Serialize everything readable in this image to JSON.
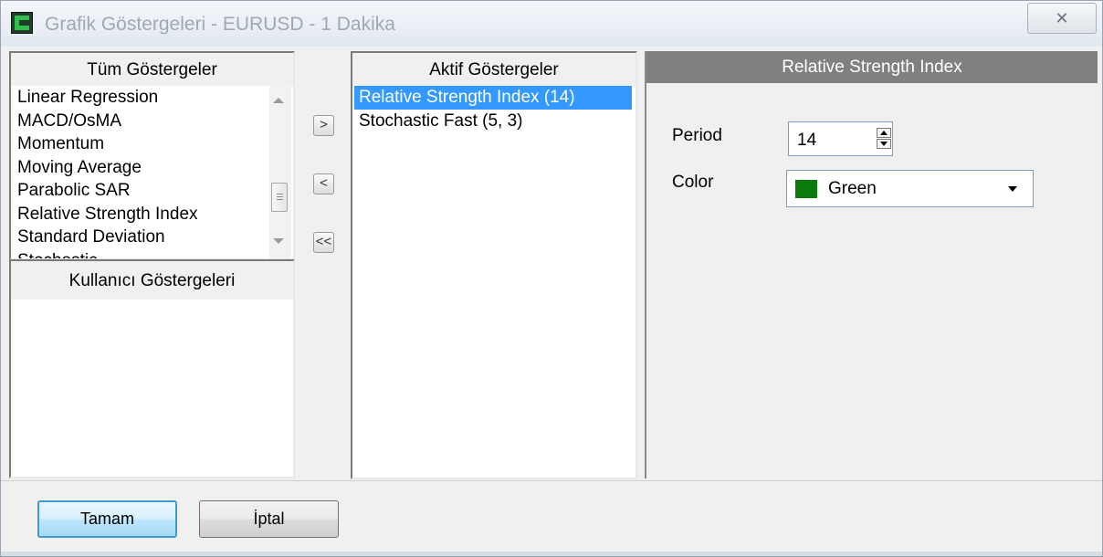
{
  "window": {
    "title": "Grafik Göstergeleri - EURUSD - 1 Dakika",
    "close_glyph": "✕"
  },
  "all_indicators": {
    "header": "Tüm Göstergeler",
    "items": [
      "Linear Regression",
      "MACD/OsMA",
      "Momentum",
      "Moving Average",
      "Parabolic SAR",
      "Relative Strength Index",
      "Standard Deviation",
      "Stochastic"
    ]
  },
  "user_indicators": {
    "header": "Kullanıcı Göstergeleri"
  },
  "move_buttons": {
    "add": ">",
    "remove": "<",
    "remove_all": "<<"
  },
  "active_indicators": {
    "header": "Aktif Göstergeler",
    "items": [
      "Relative Strength Index (14)",
      "Stochastic Fast (5, 3)"
    ],
    "selected_index": 0
  },
  "properties": {
    "header": "Relative Strength Index",
    "period_label": "Period",
    "period_value": "14",
    "color_label": "Color",
    "color_value": "Green",
    "color_swatch": "#0a7a0a"
  },
  "buttons": {
    "ok": "Tamam",
    "cancel": "İptal"
  },
  "colors": {
    "selection": "#3399ff",
    "props_header": "#808080"
  }
}
